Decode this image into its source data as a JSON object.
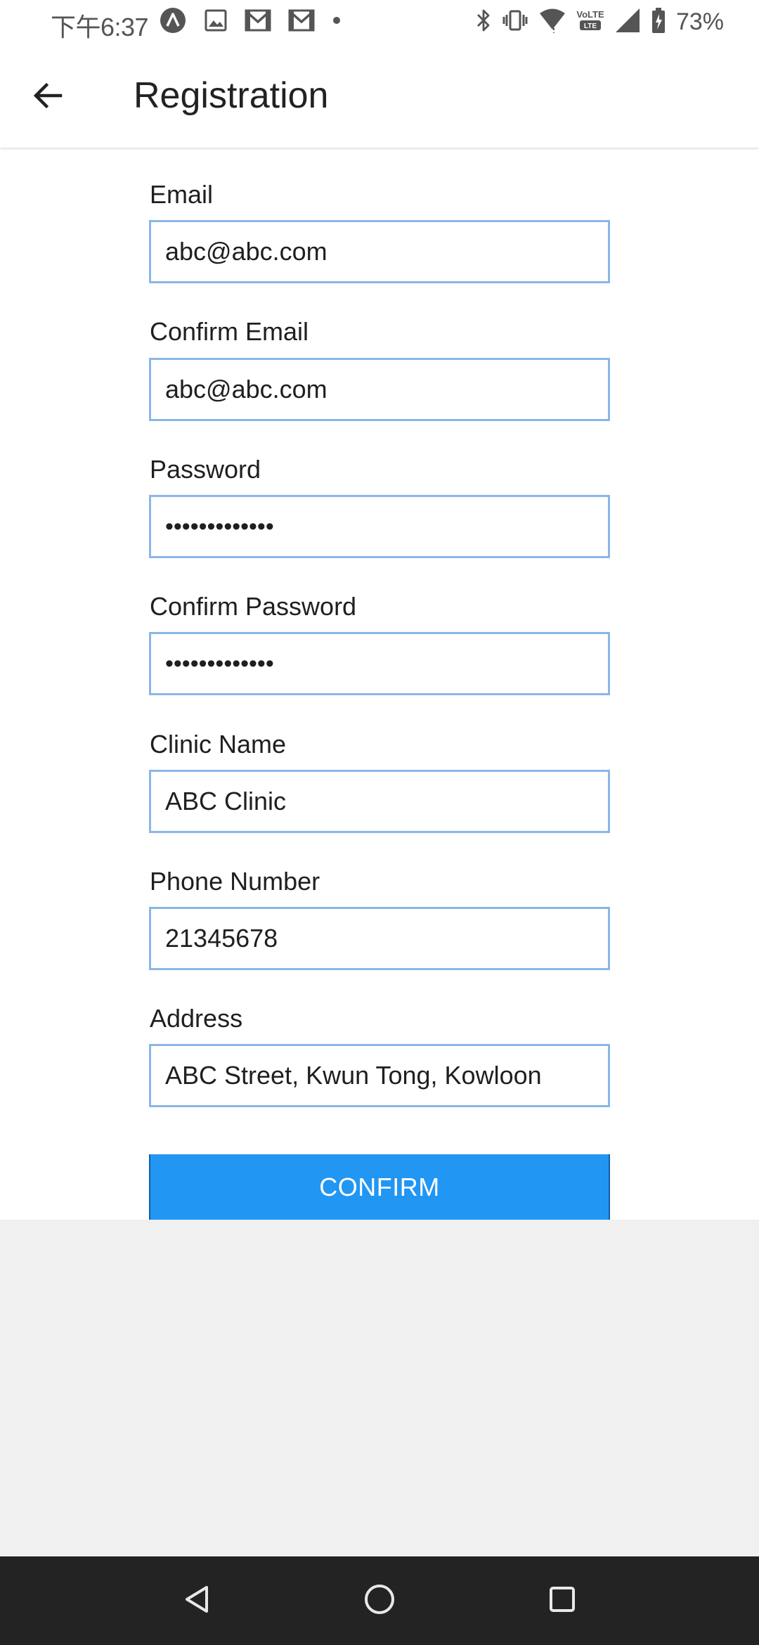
{
  "status_bar": {
    "time": "下午6:37",
    "battery": "73%",
    "left_icons": [
      "vpn-icon",
      "image-icon",
      "gmail-icon",
      "gmail-icon",
      "dot-icon"
    ],
    "right_icons": [
      "bluetooth-icon",
      "vibrate-icon",
      "wifi-icon",
      "volte-icon",
      "signal-icon",
      "battery-icon"
    ]
  },
  "app_bar": {
    "title": "Registration",
    "back_icon": "arrow-back-icon"
  },
  "form": {
    "fields": [
      {
        "label": "Email",
        "value": "abc@abc.com",
        "type": "email"
      },
      {
        "label": "Confirm Email",
        "value": "abc@abc.com",
        "type": "email"
      },
      {
        "label": "Password",
        "value": "•••••••••••••",
        "type": "password"
      },
      {
        "label": "Confirm Password",
        "value": "•••••••••••••",
        "type": "password"
      },
      {
        "label": "Clinic Name",
        "value": "ABC Clinic",
        "type": "text"
      },
      {
        "label": "Phone Number",
        "value": "21345678",
        "type": "tel"
      },
      {
        "label": "Address",
        "value": "ABC Street, Kwun Tong, Kowloon",
        "type": "text"
      }
    ],
    "confirm_label": "CONFIRM"
  },
  "nav_bar": {
    "buttons": [
      "back-triangle-icon",
      "home-circle-icon",
      "recents-square-icon"
    ]
  },
  "colors": {
    "accent": "#2196f3",
    "input_border": "#8ab6e8",
    "nav_bar_bg": "#232323",
    "page_bg": "#f0f0f0"
  }
}
